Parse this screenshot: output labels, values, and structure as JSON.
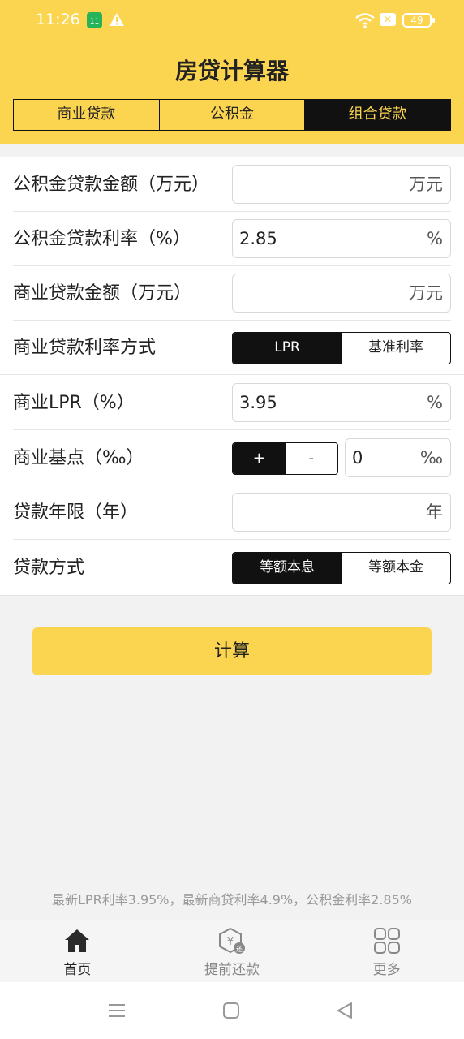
{
  "status_bar": {
    "time": "11:26",
    "app_badge": "11",
    "battery": "49",
    "icons": [
      "app-notification-icon",
      "warning-icon",
      "wifi-icon",
      "sim-icon",
      "battery-icon"
    ]
  },
  "header": {
    "title": "房贷计算器",
    "tabs": [
      {
        "label": "商业贷款",
        "active": false
      },
      {
        "label": "公积金",
        "active": false
      },
      {
        "label": "组合贷款",
        "active": true
      }
    ]
  },
  "form": {
    "fund_amount": {
      "label": "公积金贷款金额（万元）",
      "value": "",
      "unit": "万元"
    },
    "fund_rate": {
      "label": "公积金贷款利率（%）",
      "value": "2.85",
      "unit": "%"
    },
    "biz_amount": {
      "label": "商业贷款金额（万元）",
      "value": "",
      "unit": "万元"
    },
    "rate_mode": {
      "label": "商业贷款利率方式",
      "options": [
        "LPR",
        "基准利率"
      ],
      "selected": "LPR"
    },
    "biz_lpr": {
      "label": "商业LPR（%）",
      "value": "3.95",
      "unit": "%"
    },
    "biz_points": {
      "label": "商业基点（‰）",
      "plus": "+",
      "minus": "-",
      "selected": "+",
      "value": "0",
      "unit": "‰"
    },
    "years": {
      "label": "贷款年限（年）",
      "value": "",
      "unit": "年"
    },
    "method": {
      "label": "贷款方式",
      "options": [
        "等额本息",
        "等额本金"
      ],
      "selected": "等额本息"
    }
  },
  "calc_button": "计算",
  "rate_info": "最新LPR利率3.95%，最新商贷利率4.9%，公积金利率2.85%",
  "bottom_nav": [
    {
      "label": "首页",
      "icon": "home-icon",
      "active": true
    },
    {
      "label": "提前还款",
      "icon": "yuan-shield-icon",
      "active": false
    },
    {
      "label": "更多",
      "icon": "grid-icon",
      "active": false
    }
  ],
  "system_nav": [
    "menu-icon",
    "home-square-icon",
    "back-triangle-icon"
  ],
  "colors": {
    "accent": "#fcd550",
    "dark": "#111111",
    "muted": "#999999"
  }
}
